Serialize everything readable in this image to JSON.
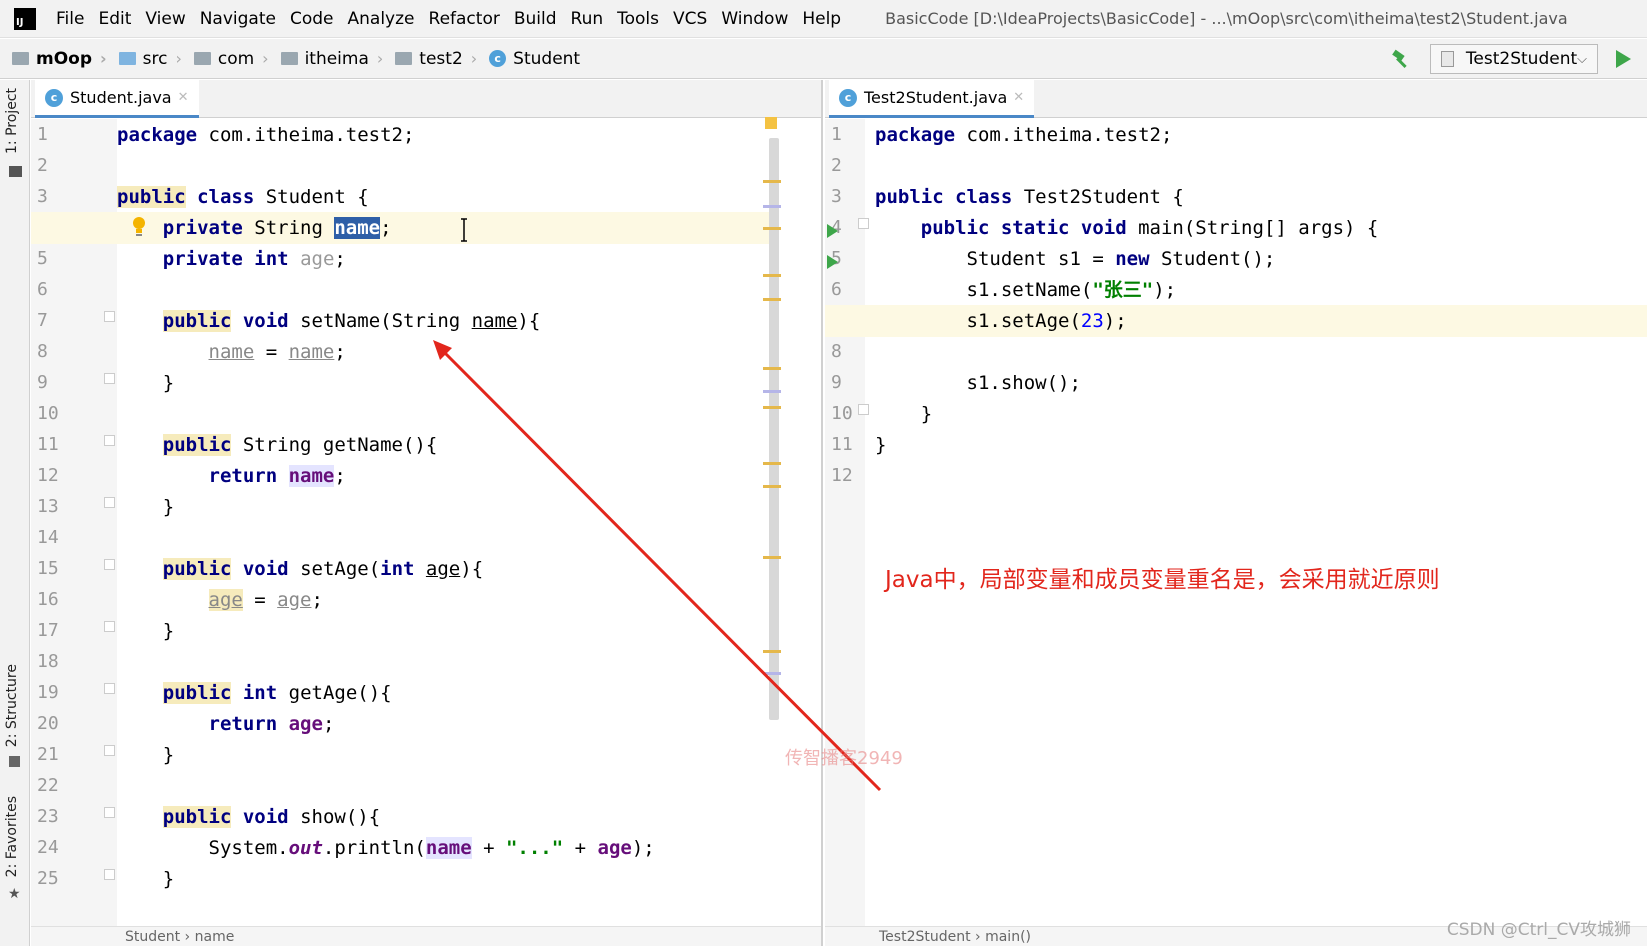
{
  "menubar": {
    "logo": "IJ",
    "items": [
      "File",
      "Edit",
      "View",
      "Navigate",
      "Code",
      "Analyze",
      "Refactor",
      "Build",
      "Run",
      "Tools",
      "VCS",
      "Window",
      "Help"
    ],
    "window_title": "BasicCode [D:\\IdeaProjects\\BasicCode] - ...\\mOop\\src\\com\\itheima\\test2\\Student.java"
  },
  "breadcrumb": {
    "items": [
      "mOop",
      "src",
      "com",
      "itheima",
      "test2",
      "Student"
    ]
  },
  "toolbar": {
    "run_config": "Test2Student"
  },
  "toolstrip": {
    "project": "1: Project",
    "structure": "2: Structure",
    "favorites": "2: Favorites"
  },
  "left_editor": {
    "tab": "Student.java",
    "line_numbers": [
      "1",
      "2",
      "3",
      "4",
      "5",
      "6",
      "7",
      "8",
      "9",
      "10",
      "11",
      "12",
      "13",
      "14",
      "15",
      "16",
      "17",
      "18",
      "19",
      "20",
      "21",
      "22",
      "23",
      "24",
      "25"
    ],
    "status_crumb": "Student  ›  name"
  },
  "right_editor": {
    "tab": "Test2Student.java",
    "line_numbers": [
      "1",
      "2",
      "3",
      "4",
      "5",
      "6",
      "7",
      "8",
      "9",
      "10",
      "11",
      "12"
    ],
    "status_crumb": "Test2Student  ›  main()"
  },
  "annotation": {
    "text": "Java中，局部变量和成员变量重名是，会采用就近原则"
  },
  "watermark": "传智播客2949",
  "csdn_credit": "CSDN @Ctrl_CV攻城狮",
  "colors": {
    "keyword": "#000080",
    "field": "#660e7a",
    "string": "#008000",
    "number": "#0000ff",
    "annotation": "#e2261c",
    "selection": "#2e5fa7"
  }
}
